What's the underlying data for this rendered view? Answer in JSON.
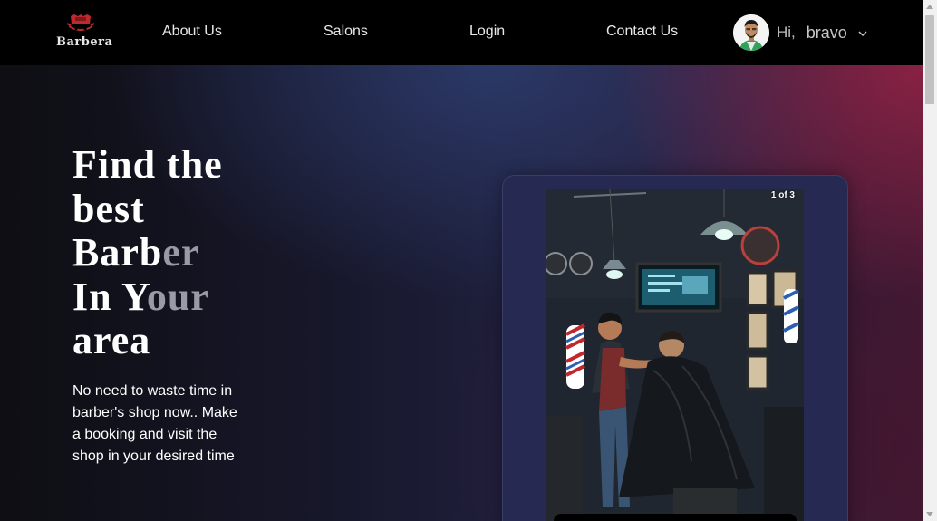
{
  "brand": {
    "name": "Barbera"
  },
  "nav": {
    "links": [
      "About Us",
      "Salons",
      "Login",
      "Contact Us"
    ]
  },
  "user": {
    "greeting": "Hi,",
    "name": "bravo",
    "menu_icon": "chevron-down-icon"
  },
  "hero": {
    "headline_lines": [
      "Find the",
      "best",
      "Barber",
      "In Your",
      "area"
    ],
    "subtitle": "No need to waste time in barber's shop now.. Make a booking and visit the shop in your desired time"
  },
  "carousel": {
    "counter": "1 of 3"
  },
  "colors": {
    "navbar": "#000000",
    "card": "#262a52",
    "accent_red": "#c0282d"
  }
}
